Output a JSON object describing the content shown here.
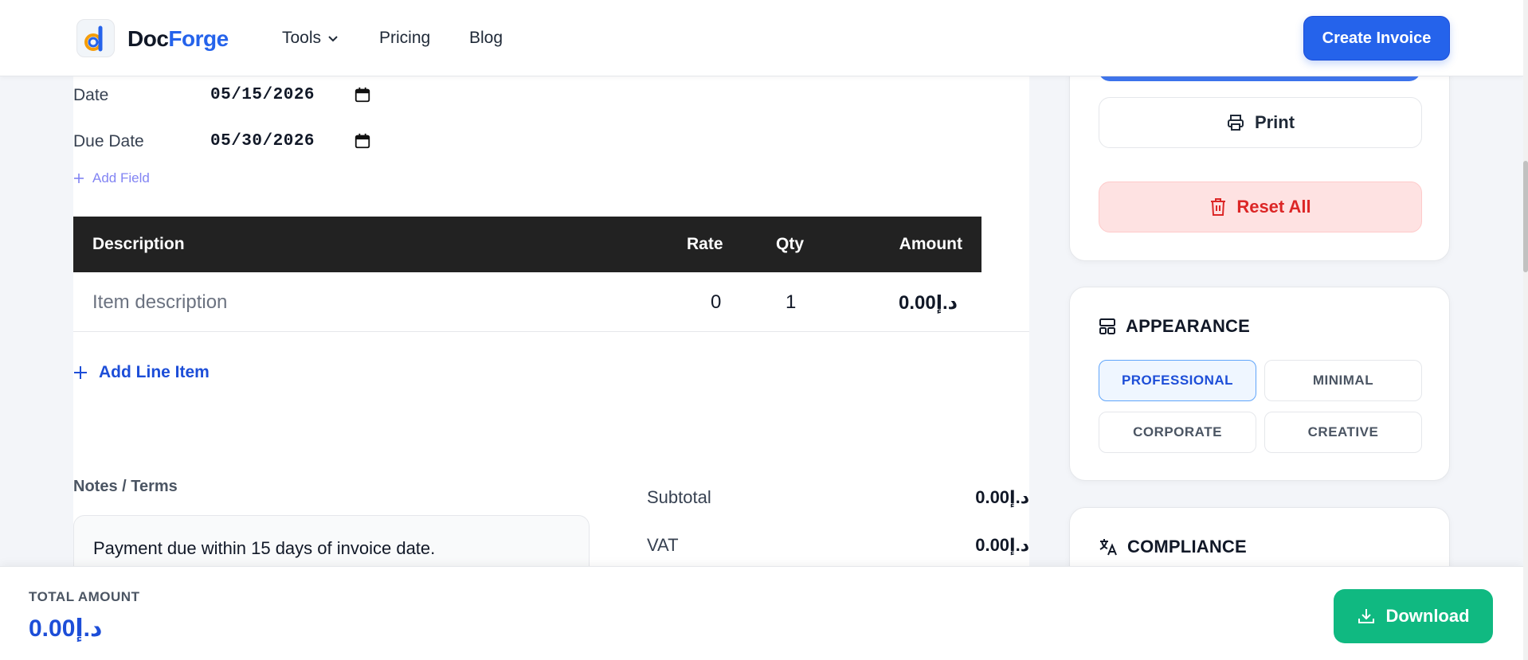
{
  "header": {
    "brand_prefix": "Doc",
    "brand_suffix": "Forge",
    "nav": {
      "tools": "Tools",
      "pricing": "Pricing",
      "blog": "Blog"
    },
    "create_button": "Create Invoice"
  },
  "invoice": {
    "fields": [
      {
        "label": "Date",
        "value": "05/15/2026"
      },
      {
        "label": "Due Date",
        "value": "05/30/2026"
      }
    ],
    "add_field": "Add Field",
    "table": {
      "headers": {
        "description": "Description",
        "rate": "Rate",
        "qty": "Qty",
        "amount": "Amount"
      },
      "rows": [
        {
          "description": "Item description",
          "rate": "0",
          "qty": "1",
          "amount": "0.00د.إ"
        }
      ]
    },
    "add_line_item": "Add Line Item",
    "notes_label": "Notes / Terms",
    "notes_text": "Payment due within 15 days of invoice date.",
    "summary": [
      {
        "label": "Subtotal",
        "value": "0.00د.إ"
      },
      {
        "label": "VAT",
        "value": "0.00د.إ"
      }
    ]
  },
  "sidebar": {
    "print": "Print",
    "reset": "Reset All",
    "appearance": {
      "title": "APPEARANCE",
      "styles": [
        "PROFESSIONAL",
        "MINIMAL",
        "CORPORATE",
        "CREATIVE"
      ],
      "selected": "PROFESSIONAL"
    },
    "compliance": {
      "title": "COMPLIANCE"
    }
  },
  "footer": {
    "total_label": "TOTAL AMOUNT",
    "total_value": "0.00د.إ",
    "download": "Download"
  },
  "colors": {
    "primary": "#2563eb",
    "success": "#10b981",
    "danger": "#dc2626",
    "table_header": "#222222"
  }
}
